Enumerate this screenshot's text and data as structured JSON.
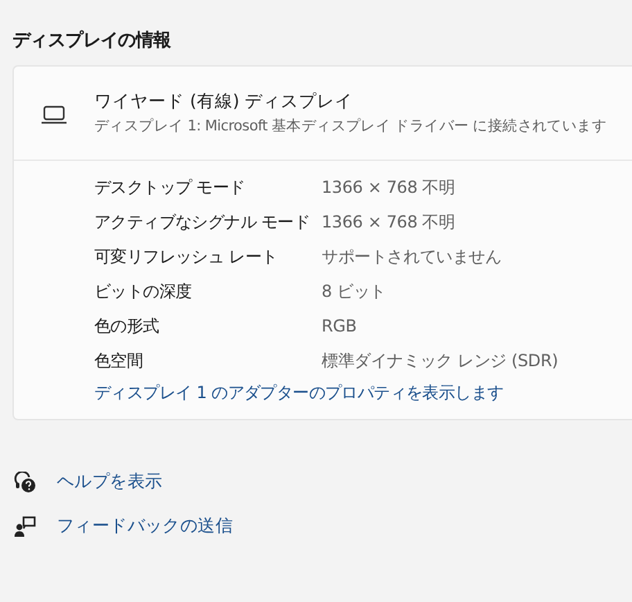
{
  "section_title": "ディスプレイの情報",
  "display": {
    "name": "ワイヤード (有線) ディスプレイ",
    "description": "ディスプレイ 1: Microsoft 基本ディスプレイ ドライバー に接続されています"
  },
  "properties": [
    {
      "label": "デスクトップ モード",
      "value": "1366 × 768 不明"
    },
    {
      "label": "アクティブなシグナル モード",
      "value": "1366 × 768 不明"
    },
    {
      "label": "可変リフレッシュ レート",
      "value": "サポートされていません"
    },
    {
      "label": "ビットの深度",
      "value": "8 ビット"
    },
    {
      "label": "色の形式",
      "value": "RGB"
    },
    {
      "label": "色空間",
      "value": "標準ダイナミック レンジ (SDR)"
    }
  ],
  "adapter_link": "ディスプレイ 1 のアダプターのプロパティを表示します",
  "footer_links": [
    {
      "kind": "help",
      "label": "ヘルプを表示"
    },
    {
      "kind": "feedback",
      "label": "フィードバックの送信"
    }
  ]
}
